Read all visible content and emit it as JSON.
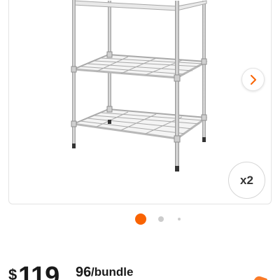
{
  "product": {
    "image_alt_subject": "wire-shelving-unit",
    "quantity_badge": "x2"
  },
  "carousel": {
    "total_slides": 3,
    "active_index": 0,
    "active_dot_color": "#F96302",
    "inactive_dot_color": "#CCCCCC",
    "next_icon": "chevron-right-icon",
    "accent_color": "#F96302"
  },
  "price": {
    "currency": "$",
    "whole": "119",
    "cents": "96",
    "unit": "/bundle"
  }
}
